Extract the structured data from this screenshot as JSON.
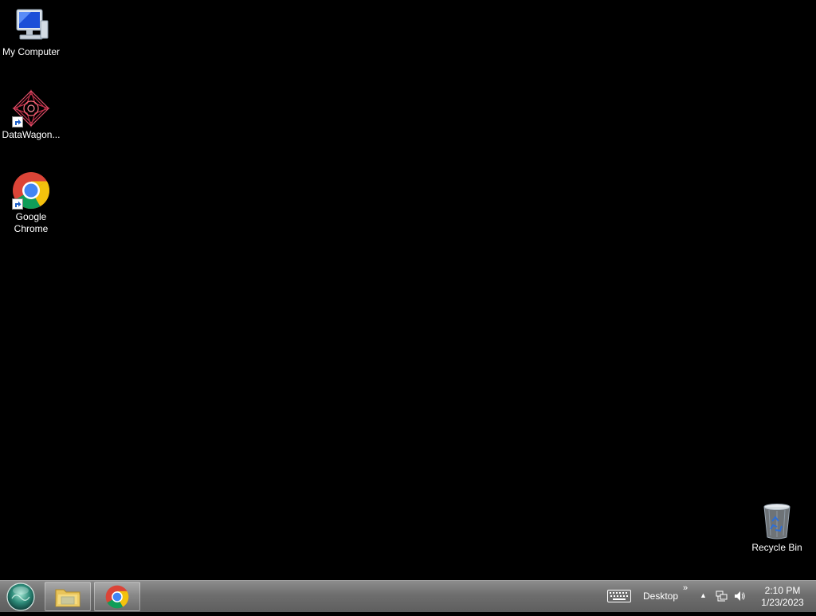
{
  "desktop": {
    "icons": [
      {
        "label": "My Computer"
      },
      {
        "label": "DataWagon..."
      },
      {
        "label": "Google\nChrome"
      },
      {
        "label": "Recycle Bin"
      }
    ]
  },
  "taskbar": {
    "toolbar_label": "Desktop",
    "overflow_chevron": "»",
    "tray_expand": "▲",
    "clock_time": "2:10 PM",
    "clock_date": "1/23/2023"
  },
  "colors": {
    "desktop_bg": "#000000",
    "taskbar": "#6e6e6e",
    "chrome_red": "#db4437",
    "chrome_yellow": "#f4c20d",
    "chrome_green": "#0f9d58",
    "chrome_blue": "#4285f4"
  }
}
